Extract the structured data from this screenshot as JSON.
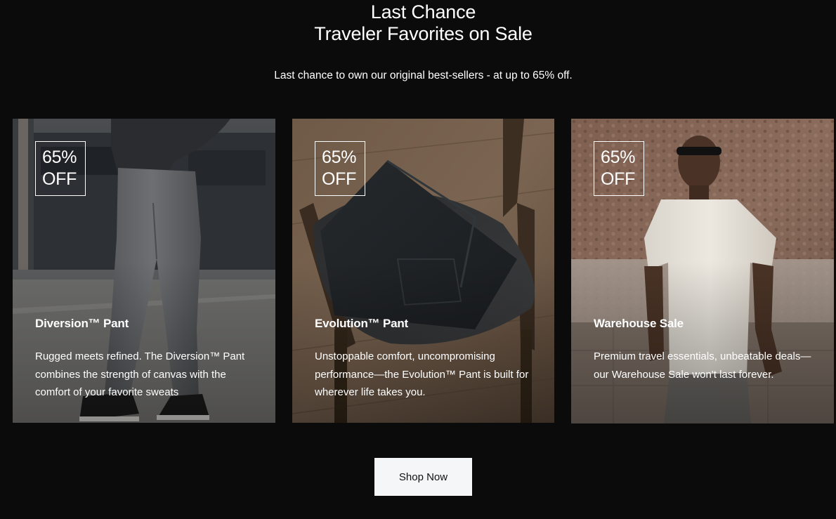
{
  "heading": {
    "line1": "Last Chance",
    "line2": "Traveler Favorites on Sale"
  },
  "subtitle": "Last chance to own our original best-sellers - at up to 65% off.",
  "cards": [
    {
      "badge_percent": "65%",
      "badge_off": "OFF",
      "title": "Diversion™ Pant",
      "description": "Rugged meets refined. The Diversion™ Pant combines the strength of canvas with the comfort of your favorite sweats",
      "image": "man-in-grey-pants-and-sneakers-photo"
    },
    {
      "badge_percent": "65%",
      "badge_off": "OFF",
      "title": "Evolution™ Pant",
      "description": "Unstoppable comfort, uncompromising performance—the Evolution™ Pant is built for wherever life takes you.",
      "image": "folded-dark-pants-on-chair-photo"
    },
    {
      "badge_percent": "65%",
      "badge_off": "OFF",
      "title": "Warehouse Sale",
      "description": "Premium travel essentials, unbeatable deals—our Warehouse Sale won't last forever.",
      "image": "man-in-white-tshirt-and-sunglasses-photo"
    }
  ],
  "cta": {
    "label": "Shop Now"
  },
  "colors": {
    "background": "#0b0b0b",
    "text": "#ffffff",
    "button_bg": "#f5f6f7",
    "button_text": "#111111"
  }
}
